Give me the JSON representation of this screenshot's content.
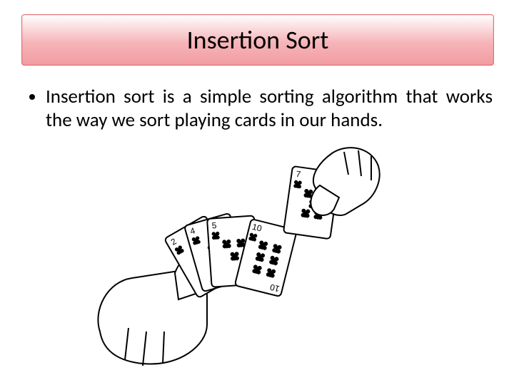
{
  "title": "Insertion Sort",
  "bullets": [
    "Insertion sort is a simple sorting algorithm that works the way we sort playing cards in our hands."
  ],
  "cards": {
    "left_hand": [
      "2",
      "4",
      "5",
      "10"
    ],
    "right_hand": "7",
    "suit": "clubs"
  }
}
